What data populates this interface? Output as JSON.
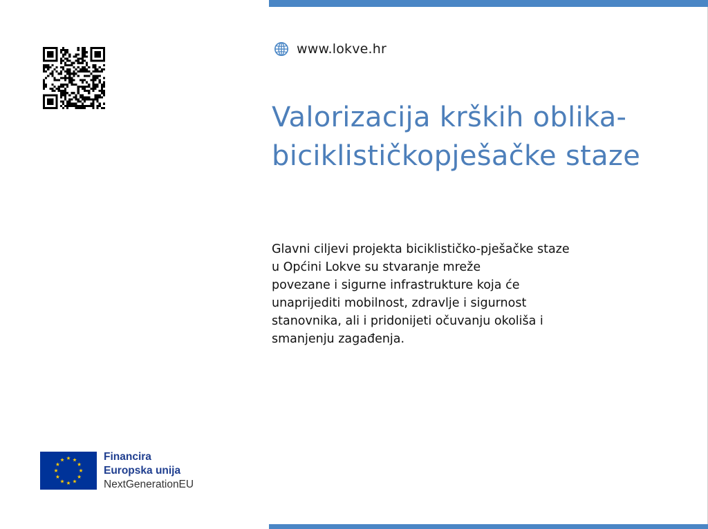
{
  "colors": {
    "accent": "#4a86c5",
    "title": "#4d7fba",
    "eu_blue": "#003399",
    "eu_star": "#ffcc00"
  },
  "website": {
    "icon": "globe-icon",
    "text": "www.lokve.hr"
  },
  "title": {
    "lines": [
      "Valorizacija krških oblika-",
      "biciklističkopješačke staze"
    ]
  },
  "body": {
    "lines": [
      "Glavni ciljevi projekta biciklističko-pješačke staze",
      "u Općini Lokve su stvaranje mreže",
      "povezane i sigurne infrastrukture koja će",
      "unaprijediti mobilnost, zdravlje i sigurnost",
      "stanovnika, ali i pridonijeti očuvanju okoliša i",
      "smanjenju zagađenja."
    ]
  },
  "funding": {
    "icon": "eu-flag-icon",
    "line1": "Financira",
    "line2": "Europska unija",
    "line3": "NextGenerationEU"
  }
}
